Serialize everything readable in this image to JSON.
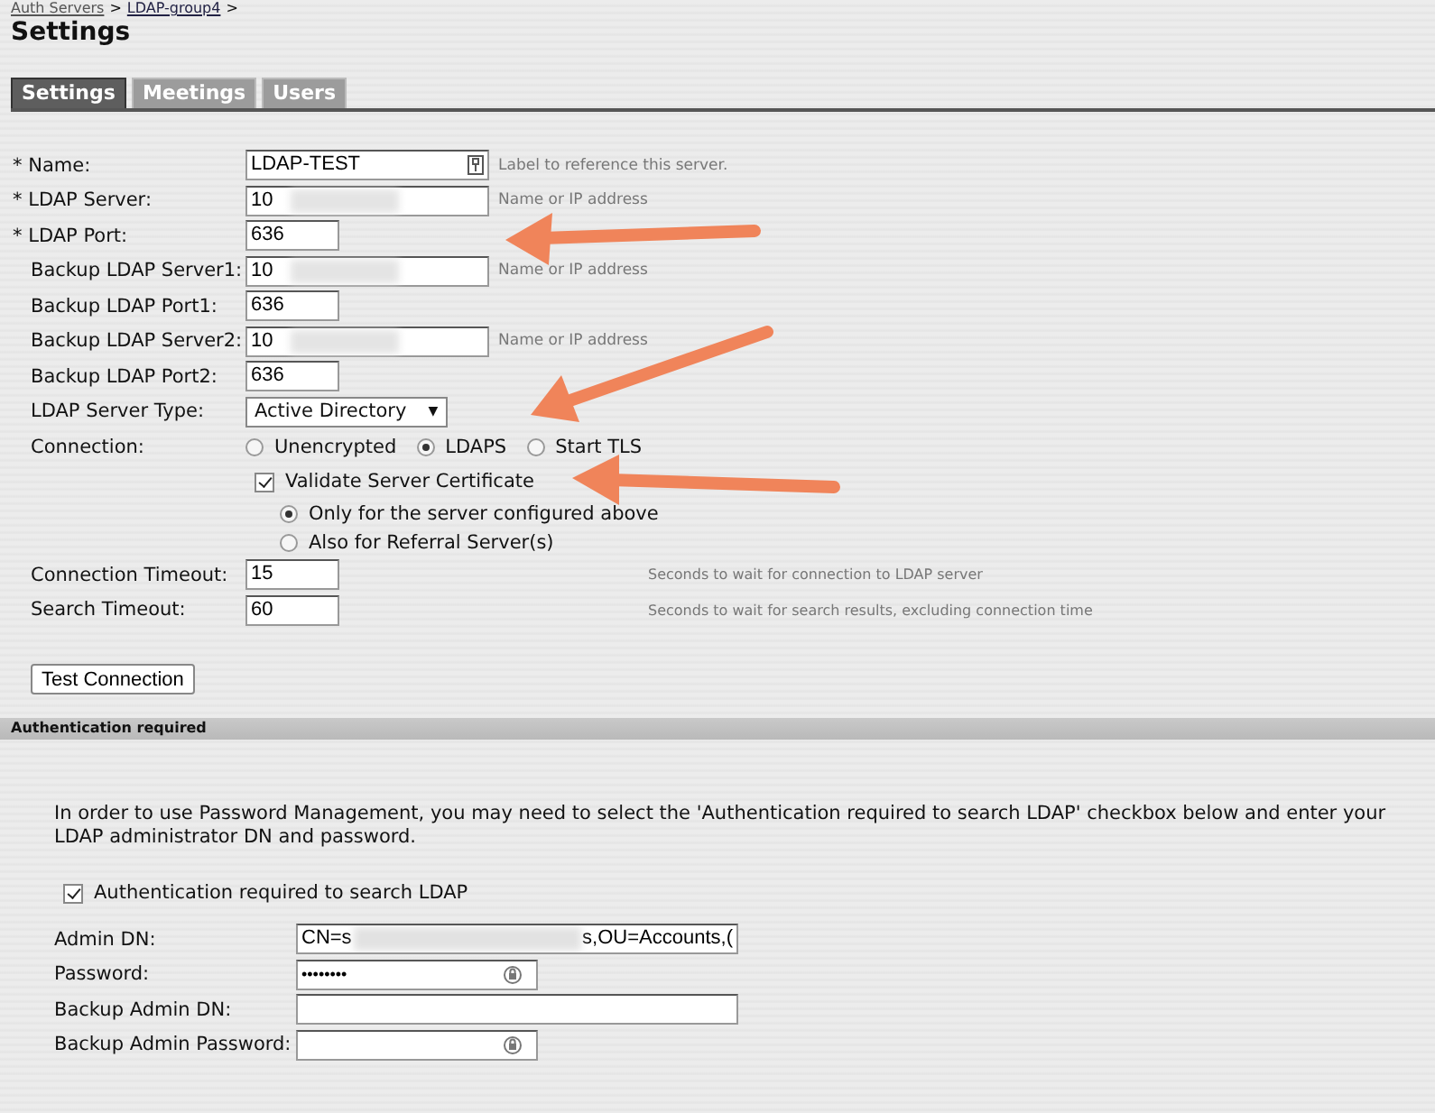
{
  "breadcrumb": [
    {
      "label": "Auth Servers",
      "separator": ">"
    },
    {
      "label": "LDAP-group4",
      "separator": ">"
    }
  ],
  "title": "Settings",
  "tabs": [
    {
      "label": "Settings",
      "selected": true
    },
    {
      "label": "Meetings",
      "selected": false
    },
    {
      "label": "Users",
      "selected": false
    }
  ],
  "fields": [
    {
      "kind": "name",
      "label": "* Name:",
      "required": true,
      "value": "LDAP-TEST",
      "hint": "Label to reference this server."
    },
    {
      "kind": "address",
      "label": "* LDAP Server:",
      "required": true,
      "value": "10",
      "redacted": true,
      "hint": "Name or IP address"
    },
    {
      "kind": "port",
      "label": "* LDAP Port:",
      "required": true,
      "value": "636"
    },
    {
      "kind": "address",
      "label": "Backup LDAP Server1:",
      "required": false,
      "value": "10",
      "redacted": true,
      "hint": "Name or IP address"
    },
    {
      "kind": "port",
      "label": "Backup LDAP Port1:",
      "required": false,
      "value": "636"
    },
    {
      "kind": "address",
      "label": "Backup LDAP Server2:",
      "required": false,
      "value": "10",
      "redacted": true,
      "hint": "Name or IP address"
    },
    {
      "kind": "port",
      "label": "Backup LDAP Port2:",
      "required": false,
      "value": "636"
    },
    {
      "kind": "select",
      "label": "LDAP Server Type:",
      "required": false,
      "value": "Active Directory",
      "caret": "▼"
    },
    {
      "kind": "radios",
      "label": "Connection:",
      "required": false,
      "options": [
        {
          "label": "Unencrypted",
          "selected": false
        },
        {
          "label": "LDAPS",
          "selected": true
        },
        {
          "label": "Start TLS",
          "selected": false
        }
      ]
    },
    {
      "kind": "checkbox",
      "label": "Validate Server Certificate",
      "checked": true
    },
    {
      "kind": "subradios",
      "options": [
        {
          "label": "Only for the server configured above",
          "selected": true
        },
        {
          "label": "Also for Referral Server(s)",
          "selected": false
        }
      ]
    },
    {
      "kind": "timeout",
      "label": "Connection Timeout:",
      "required": false,
      "value": "15",
      "hint": "Seconds to wait for connection to LDAP server"
    },
    {
      "kind": "timeout",
      "label": "Search Timeout:",
      "required": false,
      "value": "60",
      "hint": "Seconds to wait for search results, excluding connection time"
    }
  ],
  "test_button": "Test Connection",
  "auth_section": {
    "header": "Authentication required",
    "intro": "In order to use Password Management, you may need to select the 'Authentication required to search LDAP' checkbox below and enter your LDAP administrator DN and password.",
    "checkbox": {
      "label": "Authentication required to search LDAP",
      "checked": true
    },
    "fields": [
      {
        "kind": "dn",
        "label": "Admin DN:",
        "value_start": "CN=s",
        "value_end": "s,OU=Accounts,(",
        "redacted": true
      },
      {
        "kind": "password",
        "label": "Password:",
        "value": "••••••••"
      },
      {
        "kind": "dn",
        "label": "Backup Admin DN:",
        "redacted": false
      },
      {
        "kind": "password",
        "label": "Backup Admin Password:"
      }
    ]
  }
}
